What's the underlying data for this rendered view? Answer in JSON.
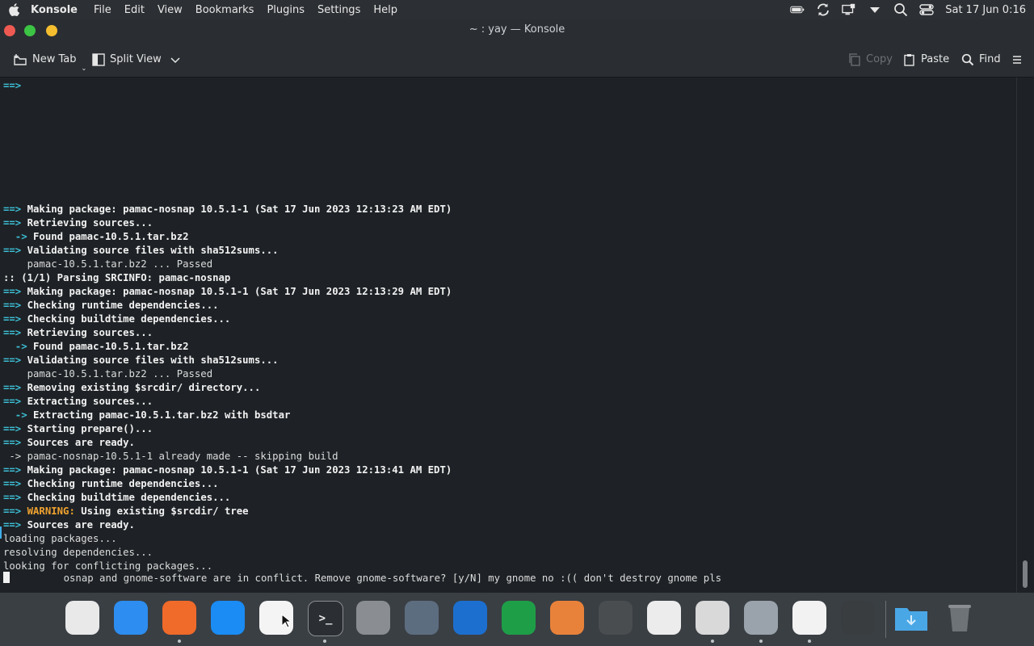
{
  "menubar": {
    "app_name": "Konsole",
    "menus": [
      "File",
      "Edit",
      "View",
      "Bookmarks",
      "Plugins",
      "Settings",
      "Help"
    ],
    "clock": "Sat 17 Jun 0:16"
  },
  "window": {
    "title": "~ : yay — Konsole"
  },
  "toolbar": {
    "new_tab": "New Tab",
    "split_view": "Split View",
    "copy": "Copy",
    "paste": "Paste",
    "find": "Find"
  },
  "terminal": {
    "first_line": "==>",
    "lines": [
      {
        "p": "==> ",
        "t": "Making package: pamac-nosnap 10.5.1-1 (Sat 17 Jun 2023 12:13:23 AM EDT)",
        "s": "bold"
      },
      {
        "p": "==> ",
        "t": "Retrieving sources...",
        "s": "bold"
      },
      {
        "p": "  -> ",
        "t": "Found pamac-10.5.1.tar.bz2",
        "s": "bold"
      },
      {
        "p": "==> ",
        "t": "Validating source files with sha512sums...",
        "s": "bold"
      },
      {
        "p": "",
        "t": "    pamac-10.5.1.tar.bz2 ... Passed",
        "s": "plain"
      },
      {
        "p": "",
        "t": ":: (1/1) Parsing SRCINFO: pamac-nosnap",
        "s": "bold"
      },
      {
        "p": "==> ",
        "t": "Making package: pamac-nosnap 10.5.1-1 (Sat 17 Jun 2023 12:13:29 AM EDT)",
        "s": "bold"
      },
      {
        "p": "==> ",
        "t": "Checking runtime dependencies...",
        "s": "bold"
      },
      {
        "p": "==> ",
        "t": "Checking buildtime dependencies...",
        "s": "bold"
      },
      {
        "p": "==> ",
        "t": "Retrieving sources...",
        "s": "bold"
      },
      {
        "p": "  -> ",
        "t": "Found pamac-10.5.1.tar.bz2",
        "s": "bold"
      },
      {
        "p": "==> ",
        "t": "Validating source files with sha512sums...",
        "s": "bold"
      },
      {
        "p": "",
        "t": "    pamac-10.5.1.tar.bz2 ... Passed",
        "s": "plain"
      },
      {
        "p": "==> ",
        "t": "Removing existing $srcdir/ directory...",
        "s": "bold"
      },
      {
        "p": "==> ",
        "t": "Extracting sources...",
        "s": "bold"
      },
      {
        "p": "  -> ",
        "t": "Extracting pamac-10.5.1.tar.bz2 with bsdtar",
        "s": "bold"
      },
      {
        "p": "==> ",
        "t": "Starting prepare()...",
        "s": "bold"
      },
      {
        "p": "==> ",
        "t": "Sources are ready.",
        "s": "bold"
      },
      {
        "p": "",
        "t": " -> pamac-nosnap-10.5.1-1 already made -- skipping build",
        "s": "plain"
      },
      {
        "p": "==> ",
        "t": "Making package: pamac-nosnap 10.5.1-1 (Sat 17 Jun 2023 12:13:41 AM EDT)",
        "s": "bold"
      },
      {
        "p": "==> ",
        "t": "Checking runtime dependencies...",
        "s": "bold"
      },
      {
        "p": "==> ",
        "t": "Checking buildtime dependencies...",
        "s": "bold"
      },
      {
        "p": "==> ",
        "w": "WARNING:",
        "t": " Using existing $srcdir/ tree",
        "s": "bold"
      },
      {
        "p": "==> ",
        "t": "Sources are ready.",
        "s": "bold"
      },
      {
        "p": "",
        "t": "loading packages...",
        "s": "plain"
      },
      {
        "p": "",
        "t": "resolving dependencies...",
        "s": "plain"
      },
      {
        "p": "",
        "t": "looking for conflicting packages..."
      }
    ],
    "prompt_line": "         osnap and gnome-software are in conflict. Remove gnome-software? [y/N] my gnome no :(( don't destroy gnome pls"
  },
  "dock": {
    "items": [
      {
        "name": "launchpad-icon",
        "color": "#e9e9e9",
        "dot": false
      },
      {
        "name": "finder-icon",
        "color": "#2d8df0",
        "dot": false
      },
      {
        "name": "firefox-icon",
        "color": "#f06a2a",
        "dot": true
      },
      {
        "name": "app-store-icon",
        "color": "#1a8cf4",
        "dot": false
      },
      {
        "name": "photos-icon",
        "color": "#f4f4f4",
        "dot": false
      },
      {
        "name": "terminal-icon",
        "color": "#2b2f33",
        "dot": true
      },
      {
        "name": "system-settings-icon",
        "color": "#8a8e93",
        "dot": false
      },
      {
        "name": "screenshot-icon",
        "color": "#5d6d80",
        "dot": false
      },
      {
        "name": "writer-icon",
        "color": "#1c6fcf",
        "dot": false
      },
      {
        "name": "calc-icon",
        "color": "#1f9e48",
        "dot": false
      },
      {
        "name": "drawing-icon",
        "color": "#e8823a",
        "dot": false
      },
      {
        "name": "tape-icon",
        "color": "#4a4d50",
        "dot": false
      },
      {
        "name": "text-editor-icon",
        "color": "#ececec",
        "dot": false
      },
      {
        "name": "tools-icon",
        "color": "#d9d9d9",
        "dot": true
      },
      {
        "name": "disk-installer-icon",
        "color": "#9aa3ab",
        "dot": true
      },
      {
        "name": "xserver-icon",
        "color": "#f2f2f2",
        "dot": true
      },
      {
        "name": "calculator-icon",
        "color": "#3a3d40",
        "dot": false
      },
      {
        "name": "downloads-folder-icon",
        "color": "#4aa7e6",
        "dot": false
      },
      {
        "name": "trash-icon",
        "color": "#6e7378",
        "dot": false
      }
    ]
  }
}
